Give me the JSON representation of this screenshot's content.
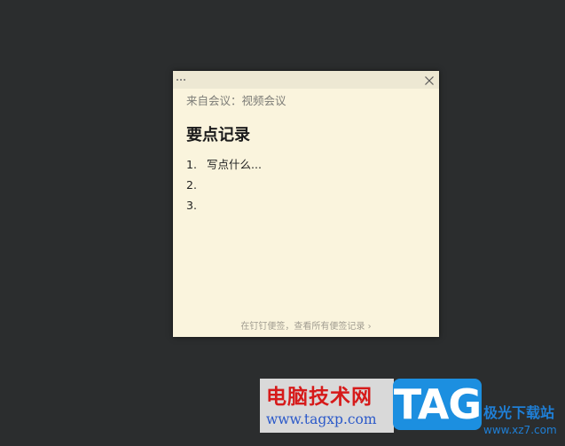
{
  "note": {
    "source": "来自会议：视频会议",
    "heading": "要点记录",
    "items": [
      {
        "num": "1.",
        "text": "写点什么..."
      },
      {
        "num": "2.",
        "text": ""
      },
      {
        "num": "3.",
        "text": ""
      }
    ],
    "footer": "在钉钉便签，查看所有便签记录 ›",
    "icons": {
      "menu": "more-horizontal-icon",
      "close": "close-icon"
    },
    "colors": {
      "background": "#faf4dd",
      "titlebar": "#ede8d3",
      "desktop": "#2b2d2e"
    }
  },
  "watermark": {
    "site_name": "电脑技术网",
    "site_url": "www.tagxp.com",
    "logo_text": "TAG",
    "site_name_right": "极光下载站",
    "site_url_right": "www.xz7.com"
  }
}
